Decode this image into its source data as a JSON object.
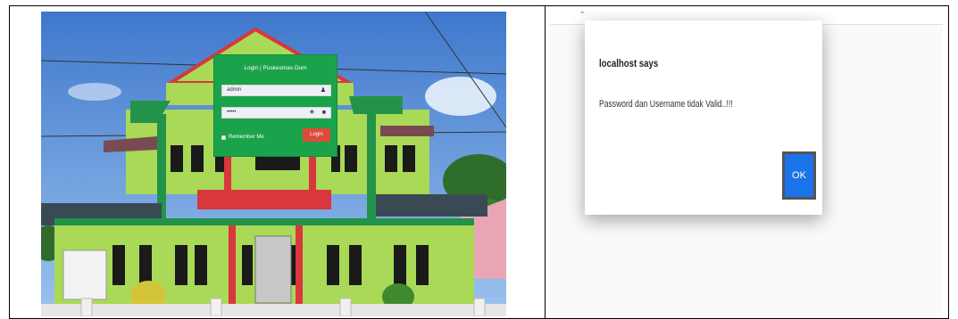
{
  "login_page": {
    "title": "Login | Puskesmas Dum",
    "username_value": "admin",
    "password_value": "•••••",
    "remember_label": "Remember Me",
    "login_button": "Login"
  },
  "alert_dialog": {
    "title": "localhost says",
    "message": "Password dan Username tidak Valid..!!!",
    "ok_button": "OK"
  },
  "colors": {
    "login_green": "#1aa34a",
    "login_button_red": "#dd4b39",
    "ok_button_blue": "#1a73e8",
    "building_lime": "#a9d957",
    "building_dark_green": "#23934a",
    "roof_red": "#d9363e"
  }
}
